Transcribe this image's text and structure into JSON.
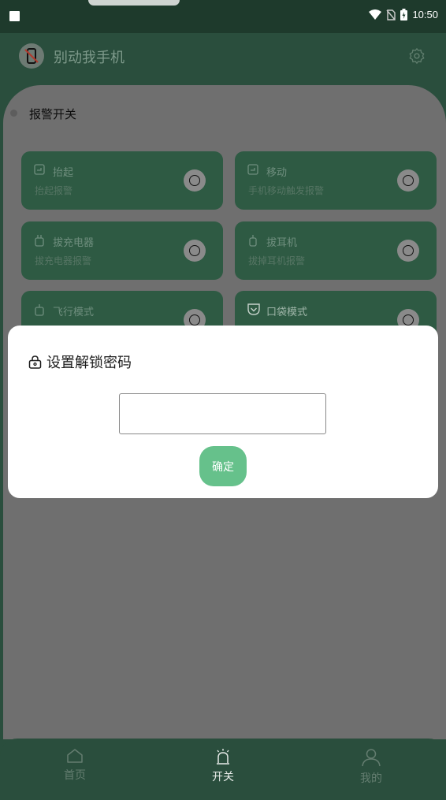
{
  "status_bar": {
    "time": "10:50"
  },
  "header": {
    "title": "别动我手机"
  },
  "section": {
    "title": "报警开关"
  },
  "cards": [
    {
      "title": "抬起",
      "subtitle": "抬起报警",
      "icon": "phone-lift-icon"
    },
    {
      "title": "移动",
      "subtitle": "手机移动触发报警",
      "icon": "phone-move-icon"
    },
    {
      "title": "拔充电器",
      "subtitle": "拔充电器报警",
      "icon": "charger-icon"
    },
    {
      "title": "拔耳机",
      "subtitle": "拔掉耳机报警",
      "icon": "headphone-plug-icon"
    },
    {
      "title": "飞行模式",
      "subtitle": "",
      "icon": "airplane-icon"
    },
    {
      "title": "口袋模式",
      "subtitle": "",
      "icon": "pocket-icon"
    }
  ],
  "dialog": {
    "title": "设置解锁密码",
    "input_value": "",
    "confirm_label": "确定"
  },
  "nav": {
    "items": [
      {
        "label": "首页",
        "icon": "home-icon",
        "active": false
      },
      {
        "label": "开关",
        "icon": "alarm-icon",
        "active": true
      },
      {
        "label": "我的",
        "icon": "user-icon",
        "active": false
      }
    ]
  },
  "colors": {
    "accent": "#66c18b",
    "header_bg": "#2a4e3d",
    "card_bg": "#2e5a43",
    "overlay_panel": "#6f6f6f"
  }
}
